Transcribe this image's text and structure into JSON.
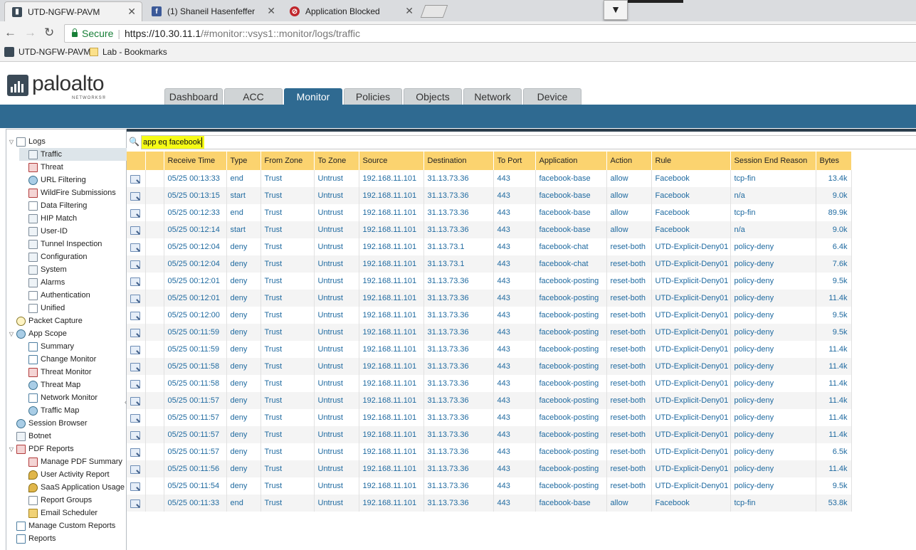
{
  "browser": {
    "tabs": [
      {
        "title": "UTD-NGFW-PAVM",
        "icon": "paloalto-icon",
        "active": true
      },
      {
        "title": "(1) Shaneil Hasenfeffer",
        "icon": "facebook-icon",
        "active": false
      },
      {
        "title": "Application Blocked",
        "icon": "paloalto-red-icon",
        "active": false
      }
    ],
    "secure_label": "Secure",
    "url_host": "https://10.30.11.1",
    "url_rest": "/#monitor::vsys1::monitor/logs/traffic",
    "bookmarks": [
      {
        "label": "UTD-NGFW-PAVM",
        "icon": "paloalto-icon"
      },
      {
        "label": "Lab - Bookmarks",
        "icon": "folder-icon"
      }
    ]
  },
  "header": {
    "logo_text": "paloalto",
    "logo_sub": "NETWORKS®",
    "tabs": [
      "Dashboard",
      "ACC",
      "Monitor",
      "Policies",
      "Objects",
      "Network",
      "Device"
    ],
    "active_tab": "Monitor"
  },
  "sidebar": {
    "items": [
      {
        "label": "Logs",
        "level": 0,
        "toggle": "▽",
        "selected": false
      },
      {
        "label": "Traffic",
        "level": 1,
        "selected": true
      },
      {
        "label": "Threat",
        "level": 1
      },
      {
        "label": "URL Filtering",
        "level": 1
      },
      {
        "label": "WildFire Submissions",
        "level": 1
      },
      {
        "label": "Data Filtering",
        "level": 1
      },
      {
        "label": "HIP Match",
        "level": 1
      },
      {
        "label": "User-ID",
        "level": 1
      },
      {
        "label": "Tunnel Inspection",
        "level": 1
      },
      {
        "label": "Configuration",
        "level": 1
      },
      {
        "label": "System",
        "level": 1
      },
      {
        "label": "Alarms",
        "level": 1
      },
      {
        "label": "Authentication",
        "level": 1
      },
      {
        "label": "Unified",
        "level": 1
      },
      {
        "label": "Packet Capture",
        "level": 0
      },
      {
        "label": "App Scope",
        "level": 0,
        "toggle": "▽"
      },
      {
        "label": "Summary",
        "level": 1
      },
      {
        "label": "Change Monitor",
        "level": 1
      },
      {
        "label": "Threat Monitor",
        "level": 1
      },
      {
        "label": "Threat Map",
        "level": 1
      },
      {
        "label": "Network Monitor",
        "level": 1
      },
      {
        "label": "Traffic Map",
        "level": 1
      },
      {
        "label": "Session Browser",
        "level": 0
      },
      {
        "label": "Botnet",
        "level": 0
      },
      {
        "label": "PDF Reports",
        "level": 0,
        "toggle": "▽"
      },
      {
        "label": "Manage PDF Summary",
        "level": 1
      },
      {
        "label": "User Activity Report",
        "level": 1
      },
      {
        "label": "SaaS Application Usage",
        "level": 1
      },
      {
        "label": "Report Groups",
        "level": 1
      },
      {
        "label": "Email Scheduler",
        "level": 1
      },
      {
        "label": "Manage Custom Reports",
        "level": 0
      },
      {
        "label": "Reports",
        "level": 0
      }
    ]
  },
  "filter": {
    "value": "app eq facebook"
  },
  "table": {
    "columns": [
      "Receive Time",
      "Type",
      "From Zone",
      "To Zone",
      "Source",
      "Destination",
      "To Port",
      "Application",
      "Action",
      "Rule",
      "Session End Reason",
      "Bytes"
    ],
    "rows": [
      [
        "05/25 00:13:33",
        "end",
        "Trust",
        "Untrust",
        "192.168.11.101",
        "31.13.73.36",
        "443",
        "facebook-base",
        "allow",
        "Facebook",
        "tcp-fin",
        "13.4k"
      ],
      [
        "05/25 00:13:15",
        "start",
        "Trust",
        "Untrust",
        "192.168.11.101",
        "31.13.73.36",
        "443",
        "facebook-base",
        "allow",
        "Facebook",
        "n/a",
        "9.0k"
      ],
      [
        "05/25 00:12:33",
        "end",
        "Trust",
        "Untrust",
        "192.168.11.101",
        "31.13.73.36",
        "443",
        "facebook-base",
        "allow",
        "Facebook",
        "tcp-fin",
        "89.9k"
      ],
      [
        "05/25 00:12:14",
        "start",
        "Trust",
        "Untrust",
        "192.168.11.101",
        "31.13.73.36",
        "443",
        "facebook-base",
        "allow",
        "Facebook",
        "n/a",
        "9.0k"
      ],
      [
        "05/25 00:12:04",
        "deny",
        "Trust",
        "Untrust",
        "192.168.11.101",
        "31.13.73.1",
        "443",
        "facebook-chat",
        "reset-both",
        "UTD-Explicit-Deny01",
        "policy-deny",
        "6.4k"
      ],
      [
        "05/25 00:12:04",
        "deny",
        "Trust",
        "Untrust",
        "192.168.11.101",
        "31.13.73.1",
        "443",
        "facebook-chat",
        "reset-both",
        "UTD-Explicit-Deny01",
        "policy-deny",
        "7.6k"
      ],
      [
        "05/25 00:12:01",
        "deny",
        "Trust",
        "Untrust",
        "192.168.11.101",
        "31.13.73.36",
        "443",
        "facebook-posting",
        "reset-both",
        "UTD-Explicit-Deny01",
        "policy-deny",
        "9.5k"
      ],
      [
        "05/25 00:12:01",
        "deny",
        "Trust",
        "Untrust",
        "192.168.11.101",
        "31.13.73.36",
        "443",
        "facebook-posting",
        "reset-both",
        "UTD-Explicit-Deny01",
        "policy-deny",
        "11.4k"
      ],
      [
        "05/25 00:12:00",
        "deny",
        "Trust",
        "Untrust",
        "192.168.11.101",
        "31.13.73.36",
        "443",
        "facebook-posting",
        "reset-both",
        "UTD-Explicit-Deny01",
        "policy-deny",
        "9.5k"
      ],
      [
        "05/25 00:11:59",
        "deny",
        "Trust",
        "Untrust",
        "192.168.11.101",
        "31.13.73.36",
        "443",
        "facebook-posting",
        "reset-both",
        "UTD-Explicit-Deny01",
        "policy-deny",
        "9.5k"
      ],
      [
        "05/25 00:11:59",
        "deny",
        "Trust",
        "Untrust",
        "192.168.11.101",
        "31.13.73.36",
        "443",
        "facebook-posting",
        "reset-both",
        "UTD-Explicit-Deny01",
        "policy-deny",
        "11.4k"
      ],
      [
        "05/25 00:11:58",
        "deny",
        "Trust",
        "Untrust",
        "192.168.11.101",
        "31.13.73.36",
        "443",
        "facebook-posting",
        "reset-both",
        "UTD-Explicit-Deny01",
        "policy-deny",
        "11.4k"
      ],
      [
        "05/25 00:11:58",
        "deny",
        "Trust",
        "Untrust",
        "192.168.11.101",
        "31.13.73.36",
        "443",
        "facebook-posting",
        "reset-both",
        "UTD-Explicit-Deny01",
        "policy-deny",
        "11.4k"
      ],
      [
        "05/25 00:11:57",
        "deny",
        "Trust",
        "Untrust",
        "192.168.11.101",
        "31.13.73.36",
        "443",
        "facebook-posting",
        "reset-both",
        "UTD-Explicit-Deny01",
        "policy-deny",
        "11.4k"
      ],
      [
        "05/25 00:11:57",
        "deny",
        "Trust",
        "Untrust",
        "192.168.11.101",
        "31.13.73.36",
        "443",
        "facebook-posting",
        "reset-both",
        "UTD-Explicit-Deny01",
        "policy-deny",
        "11.4k"
      ],
      [
        "05/25 00:11:57",
        "deny",
        "Trust",
        "Untrust",
        "192.168.11.101",
        "31.13.73.36",
        "443",
        "facebook-posting",
        "reset-both",
        "UTD-Explicit-Deny01",
        "policy-deny",
        "11.4k"
      ],
      [
        "05/25 00:11:57",
        "deny",
        "Trust",
        "Untrust",
        "192.168.11.101",
        "31.13.73.36",
        "443",
        "facebook-posting",
        "reset-both",
        "UTD-Explicit-Deny01",
        "policy-deny",
        "6.5k"
      ],
      [
        "05/25 00:11:56",
        "deny",
        "Trust",
        "Untrust",
        "192.168.11.101",
        "31.13.73.36",
        "443",
        "facebook-posting",
        "reset-both",
        "UTD-Explicit-Deny01",
        "policy-deny",
        "11.4k"
      ],
      [
        "05/25 00:11:54",
        "deny",
        "Trust",
        "Untrust",
        "192.168.11.101",
        "31.13.73.36",
        "443",
        "facebook-posting",
        "reset-both",
        "UTD-Explicit-Deny01",
        "policy-deny",
        "9.5k"
      ],
      [
        "05/25 00:11:33",
        "end",
        "Trust",
        "Untrust",
        "192.168.11.101",
        "31.13.73.36",
        "443",
        "facebook-base",
        "allow",
        "Facebook",
        "tcp-fin",
        "53.8k"
      ]
    ]
  }
}
